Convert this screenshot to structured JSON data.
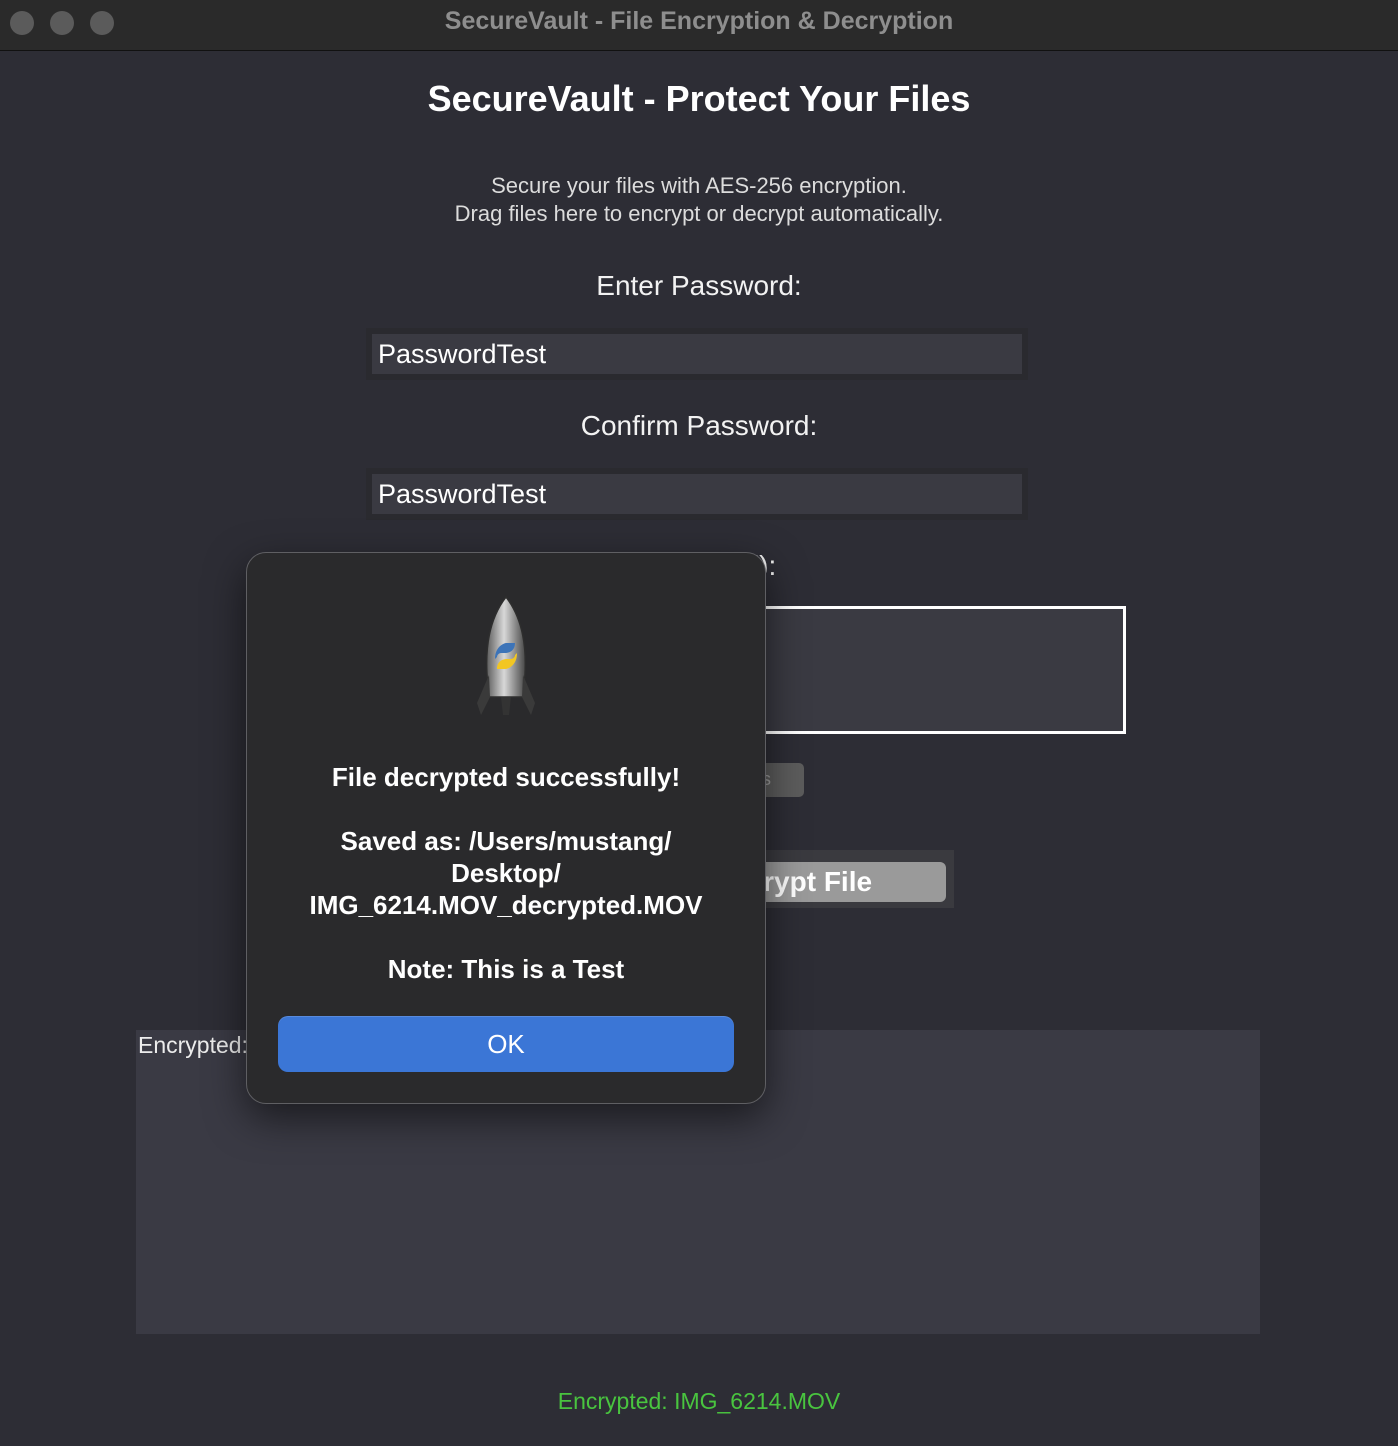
{
  "window": {
    "title": "SecureVault - File Encryption & Decryption"
  },
  "app": {
    "heading": "SecureVault - Protect Your Files",
    "subtitle_line1": "Secure your files with AES-256 encryption.",
    "subtitle_line2": "Drag files here to encrypt or decrypt automatically."
  },
  "form": {
    "password_label": "Enter Password:",
    "password_value": "PasswordTest",
    "confirm_label": "Confirm Password:",
    "confirm_value": "PasswordTest",
    "note_label_visible": "ional):",
    "small_button_visible": "s",
    "decrypt_button_visible": "ecrypt File"
  },
  "drop_zone": {
    "label_visible": "Encrypted:"
  },
  "status": {
    "text": "Encrypted: IMG_6214.MOV",
    "color": "#49c43f"
  },
  "dialog": {
    "icon": "python-rocket-icon",
    "message": "File decrypted successfully!",
    "saved_line1": "Saved as: /Users/mustang/",
    "saved_line2": "Desktop/",
    "saved_line3": "IMG_6214.MOV_decrypted.MOV",
    "note": "Note: This is a Test",
    "ok_label": "OK",
    "ok_color": "#3b76d6"
  }
}
